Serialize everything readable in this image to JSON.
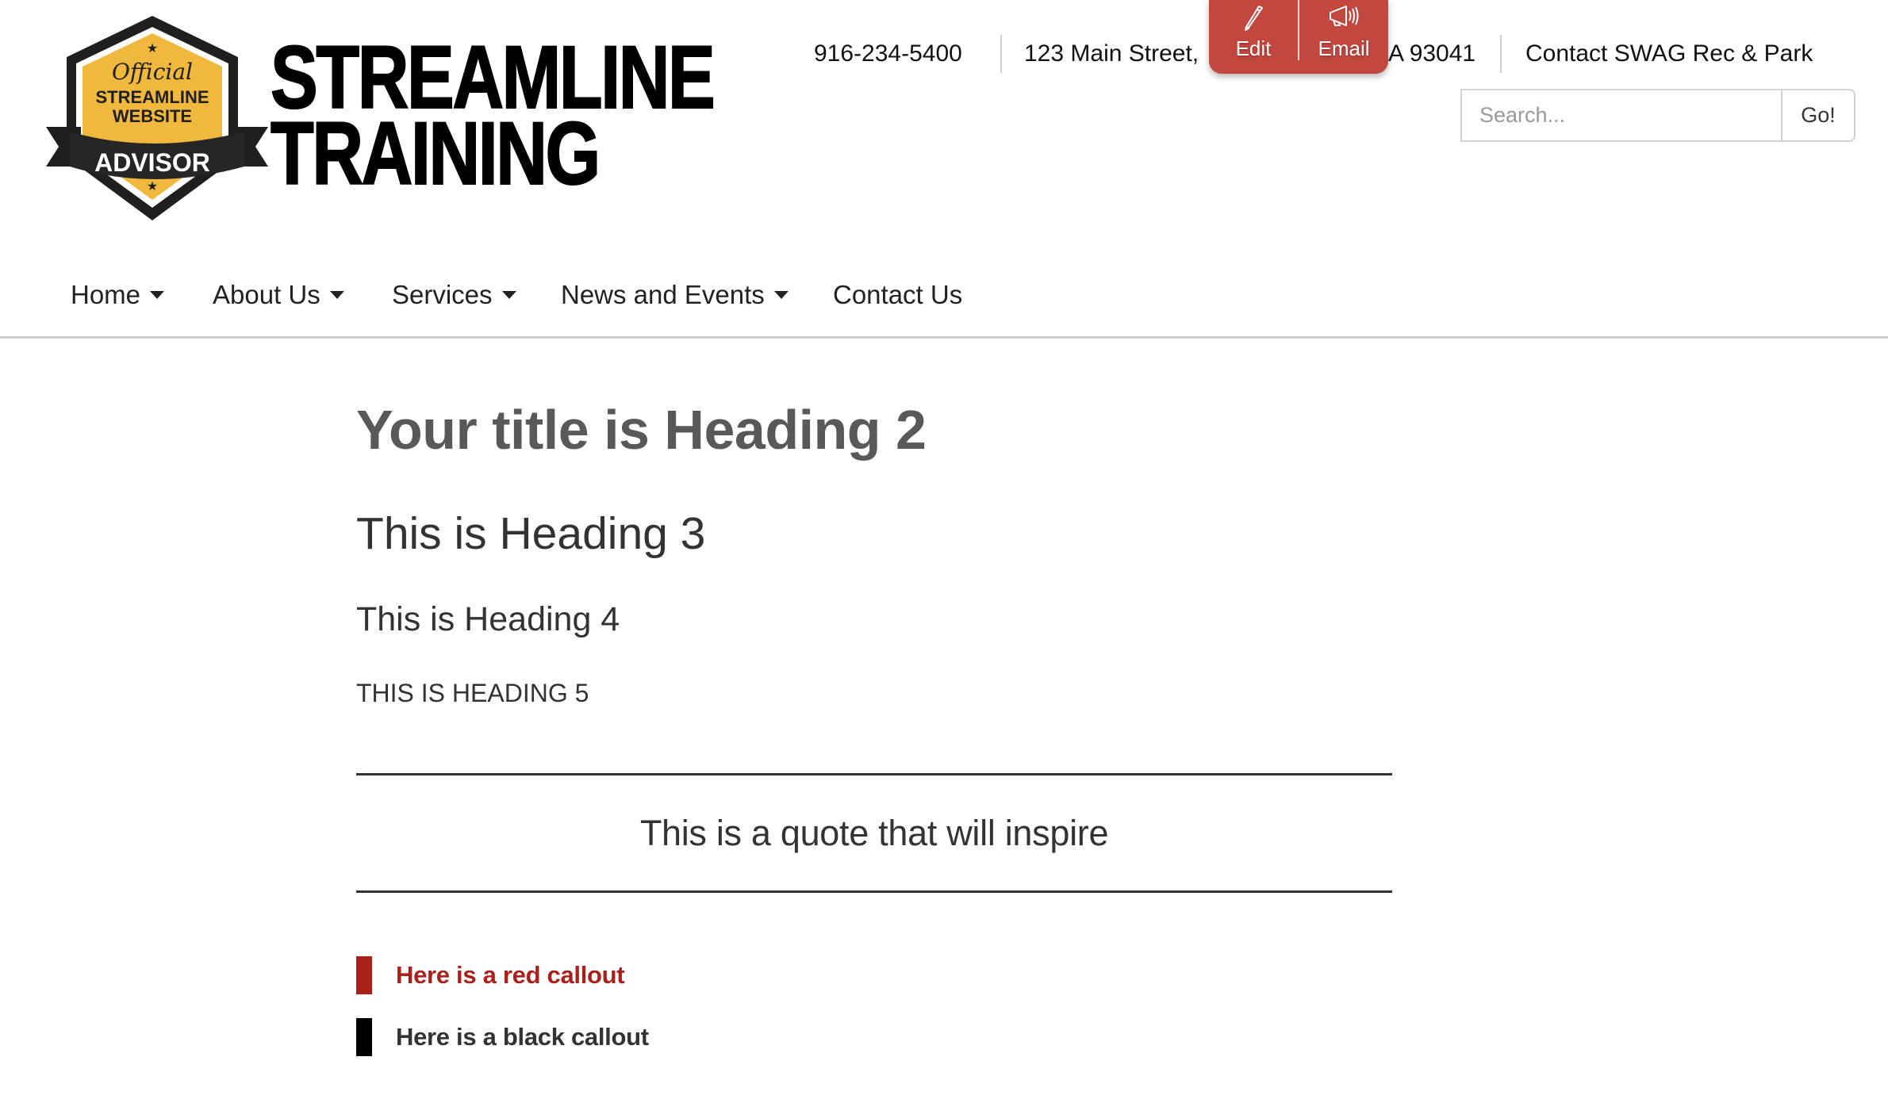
{
  "logo": {
    "badge_script": "Official",
    "badge_line1": "STREAMLINE",
    "badge_line2": "WEBSITE",
    "badge_ribbon": "ADVISOR",
    "wordmark_line1": "STREAMLINE",
    "wordmark_line2": "TRAINING",
    "colors": {
      "badge_yellow": "#f0b83c",
      "badge_dark": "#1f1f1f"
    }
  },
  "topbar": {
    "phone": "916-234-5400",
    "address_visible_start": "123 Main Street,",
    "address_visible_end": "A 93041",
    "contact_link": "Contact SWAG Rec & Park"
  },
  "popup": {
    "edit_label": "Edit",
    "edit_icon": "pencil-icon",
    "email_label": "Email",
    "email_icon": "megaphone-icon",
    "color": "#c1473f"
  },
  "search": {
    "placeholder": "Search...",
    "value": "",
    "button_label": "Go!"
  },
  "nav": {
    "items": [
      {
        "label": "Home",
        "has_dropdown": true
      },
      {
        "label": "About Us",
        "has_dropdown": true
      },
      {
        "label": "Services",
        "has_dropdown": true
      },
      {
        "label": "News and Events",
        "has_dropdown": true
      },
      {
        "label": "Contact Us",
        "has_dropdown": false
      }
    ]
  },
  "content": {
    "h2": "Your title is Heading 2",
    "h3": "This is Heading 3",
    "h4": "This is Heading 4",
    "h5": "This is Heading 5",
    "quote": "This is a quote that will inspire",
    "callouts": [
      {
        "text": "Here is a red callout",
        "color": "#a8221b",
        "bar_color": "#a8221b"
      },
      {
        "text": "Here is a black callout",
        "color": "#333333",
        "bar_color": "#000000"
      }
    ],
    "colors": {
      "heading2": "#58595b",
      "text": "#333333",
      "rule": "#333333"
    }
  }
}
